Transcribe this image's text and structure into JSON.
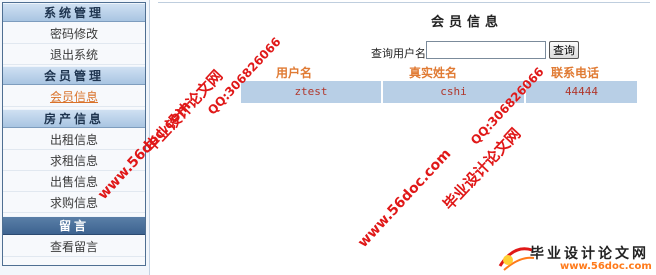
{
  "sidebar": {
    "sections": [
      {
        "title": "系统管理",
        "items": [
          "密码修改",
          "退出系统"
        ]
      },
      {
        "title": "会员管理",
        "items": [
          "会员信息"
        ]
      },
      {
        "title": "房产信息",
        "items": [
          "出租信息",
          "求租信息",
          "出售信息",
          "求购信息"
        ]
      },
      {
        "title": "留言",
        "items": [
          "查看留言"
        ]
      }
    ],
    "active_item": "会员信息"
  },
  "main": {
    "title": "会员信息",
    "search": {
      "label": "查询用户名",
      "value": "",
      "button": "查询"
    },
    "table": {
      "headers": [
        "用户名",
        "真实姓名",
        "联系电话"
      ],
      "rows": [
        [
          "ztest",
          "cshi",
          "44444"
        ]
      ]
    }
  },
  "watermark": {
    "site_cn": "毕业设计论文网",
    "site_url": "www.56doc.com",
    "qq": "QQ:306826066",
    "brand_name": "毕业设计论文网",
    "brand_url": "www.56doc.com"
  },
  "colors": {
    "accent_orange": "#e07b34",
    "row_highlight": "#b8cfe6",
    "cell_text": "#b0372c",
    "watermark_red": "#e01818"
  }
}
